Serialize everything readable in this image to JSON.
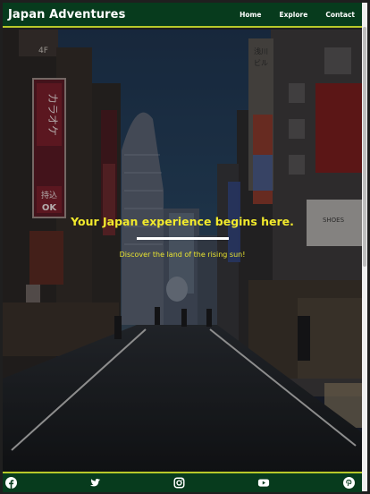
{
  "header": {
    "brand": "Japan Adventures",
    "nav": [
      {
        "label": "Home"
      },
      {
        "label": "Explore"
      },
      {
        "label": "Contact"
      }
    ]
  },
  "hero": {
    "headline": "Your Japan experience begins here.",
    "tagline": "Discover the land of the rising sun!",
    "signs": [
      "浅川",
      "ビル",
      "カラオケ",
      "持込",
      "OK",
      "4F",
      "SHOES"
    ]
  },
  "footer": {
    "social": [
      {
        "icon": "facebook-icon"
      },
      {
        "icon": "twitter-icon"
      },
      {
        "icon": "instagram-icon"
      },
      {
        "icon": "youtube-icon"
      },
      {
        "icon": "pinterest-icon"
      }
    ]
  },
  "colors": {
    "nav_bg": "#073b1d",
    "accent_border": "#b7c92a",
    "headline": "#f2ea2c",
    "divider": "#ffffff"
  }
}
